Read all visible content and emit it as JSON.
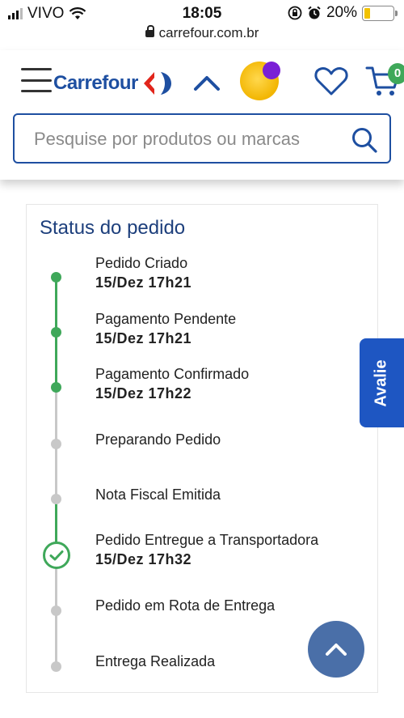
{
  "status_bar": {
    "carrier": "VIVO",
    "time": "18:05",
    "battery": "20%",
    "battery_level": 0.2
  },
  "browser": {
    "url": "carrefour.com.br"
  },
  "header": {
    "logo_text": "Carrefour",
    "cart_count": "0",
    "search_placeholder": "Pesquise por produtos ou marcas"
  },
  "order_status": {
    "title": "Status do pedido",
    "steps": [
      {
        "label": "Pedido Criado",
        "date": "15/Dez 17h21",
        "state": "done"
      },
      {
        "label": "Pagamento Pendente",
        "date": "15/Dez 17h21",
        "state": "done"
      },
      {
        "label": "Pagamento Confirmado",
        "date": "15/Dez 17h22",
        "state": "done"
      },
      {
        "label": "Preparando Pedido",
        "date": "",
        "state": "pending"
      },
      {
        "label": "Nota Fiscal Emitida",
        "date": "",
        "state": "pending"
      },
      {
        "label": "Pedido Entregue a Transportadora",
        "date": "15/Dez 17h32",
        "state": "current"
      },
      {
        "label": "Pedido em Rota de Entrega",
        "date": "",
        "state": "pending"
      },
      {
        "label": "Entrega Realizada",
        "date": "",
        "state": "pending"
      }
    ]
  },
  "feedback_tab": {
    "label": "Avalie"
  },
  "colors": {
    "brand_blue": "#1e4fa1",
    "done_green": "#3fa85a",
    "pending_grey": "#c8c8c8",
    "feedback_blue": "#1e56c2",
    "scroll_button": "#4a6fa8"
  }
}
